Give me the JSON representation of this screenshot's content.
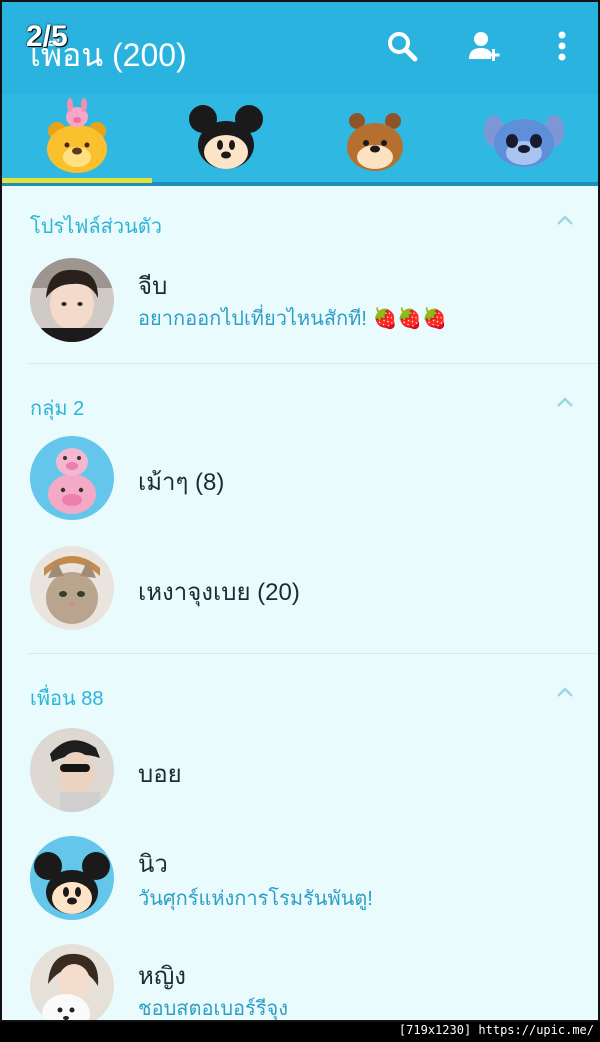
{
  "overlay": {
    "counter": "2/5"
  },
  "header": {
    "title": "เพื่อน (200)"
  },
  "sections": {
    "profile": {
      "label": "โปรไฟล์ส่วนตัว"
    },
    "groups": {
      "label": "กลุ่ม 2"
    },
    "friends": {
      "label": "เพื่อน 88"
    }
  },
  "profile": {
    "name": "จีบ",
    "status": "อยากออกไปเที่ยวไหนสักที! 🍓🍓🍓"
  },
  "groups": [
    {
      "name": "เม้าๆ (8)"
    },
    {
      "name": "เหงาจุงเบย (20)"
    }
  ],
  "friends": [
    {
      "name": "บอย",
      "status": ""
    },
    {
      "name": "นิว",
      "status": "วันศุกร์แห่งการโรมรันพันตู!"
    },
    {
      "name": "หญิง",
      "status": "ชอบสตอเบอร์รีจุง"
    }
  ],
  "watermark": "[719x1230] https://upic.me/",
  "colors": {
    "header": "#29b3de",
    "accent": "#2cb5d8",
    "background": "#eafbfd",
    "tab_indicator": "#e6e03a"
  },
  "icons": {
    "search": "search-icon",
    "add_friend": "add-friend-icon",
    "more": "more-vert-icon"
  }
}
